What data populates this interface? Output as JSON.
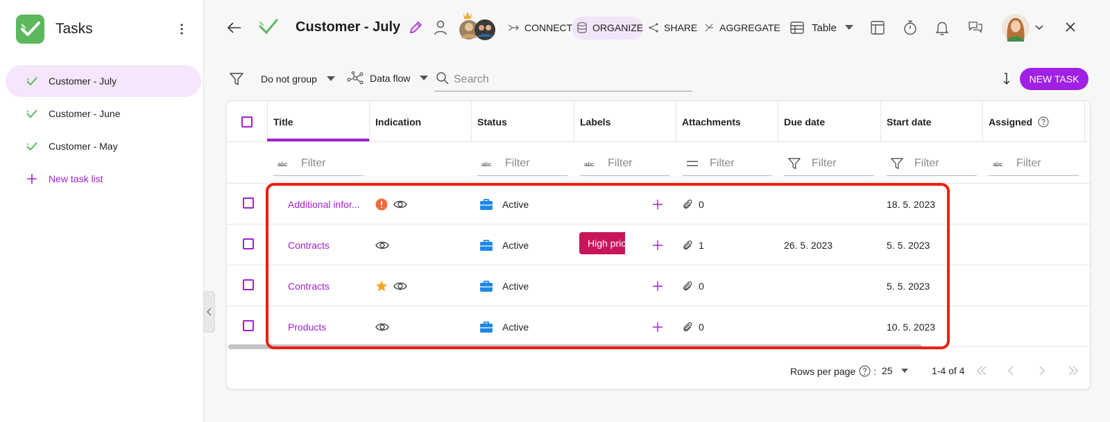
{
  "sidebar": {
    "app_title": "Tasks",
    "items": [
      {
        "label": "Customer - July",
        "active": true
      },
      {
        "label": "Customer - June",
        "active": false
      },
      {
        "label": "Customer - May",
        "active": false
      }
    ],
    "new_list_label": "New task list"
  },
  "topbar": {
    "title": "Customer - July",
    "connect_label": "CONNECT",
    "organize_label": "ORGANIZE",
    "share_label": "SHARE",
    "aggregate_label": "AGGREGATE",
    "view_label": "Table"
  },
  "toolbar": {
    "group_label": "Do not group",
    "dataflow_label": "Data flow",
    "search_placeholder": "Search",
    "new_task_label": "NEW TASK"
  },
  "table": {
    "columns": [
      "Title",
      "Indication",
      "Status",
      "Labels",
      "Attachments",
      "Due date",
      "Start date",
      "Assigned"
    ],
    "filter_placeholder": "Filter",
    "rows": [
      {
        "title": "Additional infor...",
        "indications": [
          "alert",
          "watch"
        ],
        "status": "Active",
        "label": "",
        "attachments": "0",
        "due": "",
        "start": "18. 5. 2023"
      },
      {
        "title": "Contracts",
        "indications": [
          "watch"
        ],
        "status": "Active",
        "label": "High prio",
        "attachments": "1",
        "due": "26. 5. 2023",
        "start": "5. 5. 2023"
      },
      {
        "title": "Contracts",
        "indications": [
          "star",
          "watch"
        ],
        "status": "Active",
        "label": "",
        "attachments": "0",
        "due": "",
        "start": "5. 5. 2023"
      },
      {
        "title": "Products",
        "indications": [
          "watch"
        ],
        "status": "Active",
        "label": "",
        "attachments": "0",
        "due": "",
        "start": "10. 5. 2023"
      }
    ]
  },
  "pagination": {
    "rows_per_page_label": "Rows per page",
    "rows_per_page_separator": ":",
    "rows_per_page_value": "25",
    "range_label": "1-4 of 4"
  },
  "colors": {
    "accent": "#a020d0",
    "highlight": "#f21c0e",
    "status_icon": "#1e88e5",
    "alert": "#f26b3a",
    "star": "#f5a623",
    "label_chip": "#c8165d"
  }
}
